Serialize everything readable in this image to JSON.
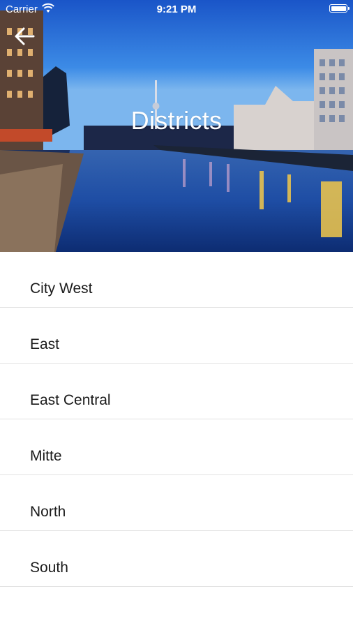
{
  "status_bar": {
    "carrier": "Carrier",
    "time": "9:21 PM",
    "wifi_icon": "wifi-icon",
    "battery_icon": "battery-icon"
  },
  "header": {
    "back_icon": "arrow-left-icon",
    "title": "Districts"
  },
  "districts": [
    {
      "label": "City West"
    },
    {
      "label": "East"
    },
    {
      "label": "East Central"
    },
    {
      "label": "Mitte"
    },
    {
      "label": "North"
    },
    {
      "label": "South"
    }
  ]
}
